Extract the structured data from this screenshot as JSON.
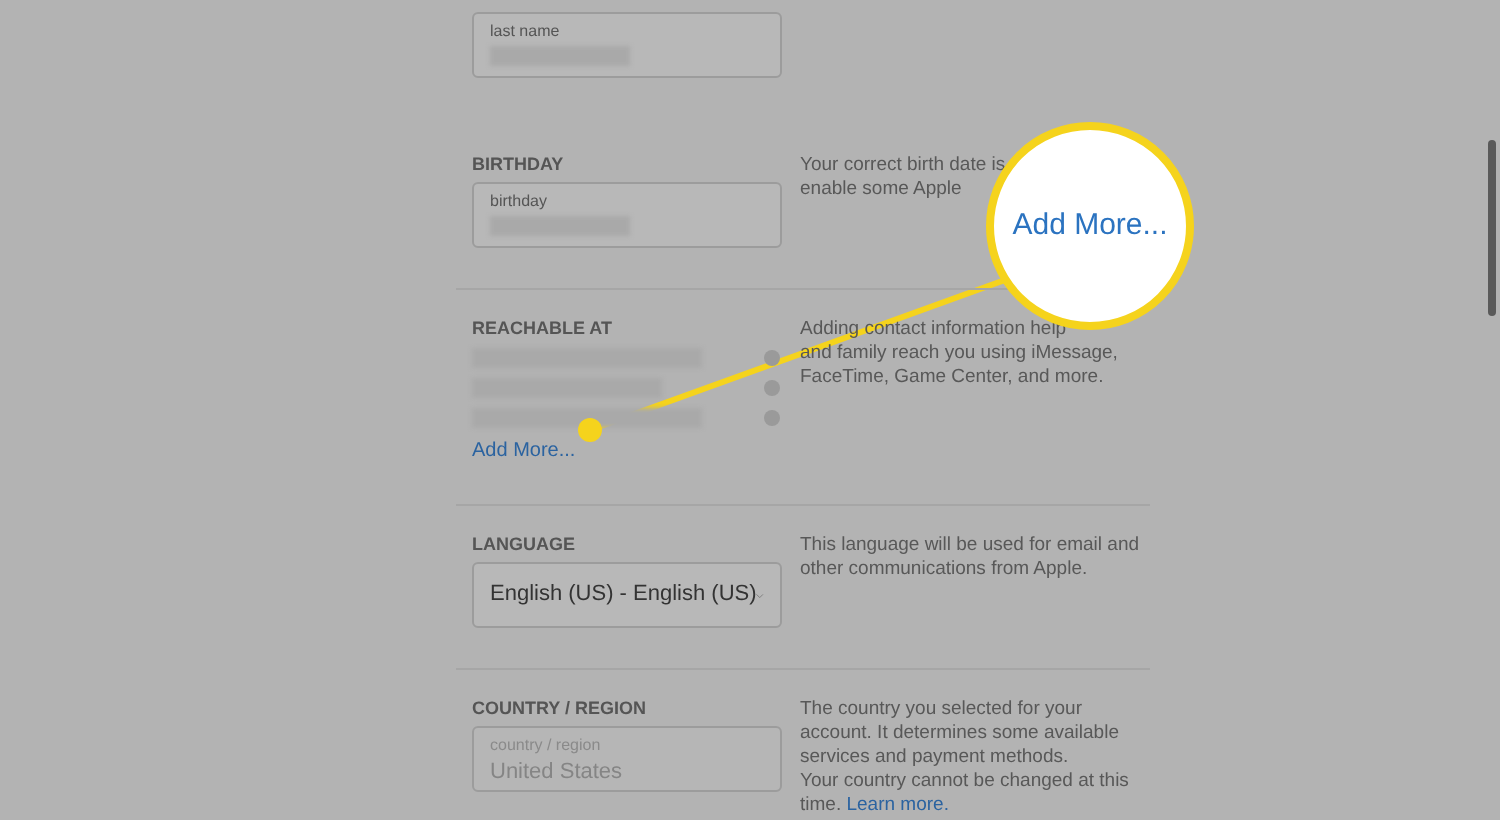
{
  "top_field": {
    "label": "last name"
  },
  "sections": [
    {
      "kind": "field",
      "heading": "BIRTHDAY",
      "field_label": "birthday",
      "disabled": false,
      "description": [
        "Your correct birth date is",
        "enable some Apple"
      ]
    },
    {
      "kind": "contacts",
      "heading": "REACHABLE AT",
      "entries": [
        {
          "kind": "redacted"
        },
        {
          "kind": "redacted"
        },
        {
          "kind": "redacted"
        }
      ],
      "link": "Add More...",
      "description": [
        "Adding contact information help",
        "and family reach you using iMessage,",
        "FaceTime, Game Center, and more."
      ]
    },
    {
      "kind": "select",
      "heading": "LANGUAGE",
      "value": "English (US) - English (US)",
      "description": [
        "This language will be used for email and",
        "other communications from Apple."
      ]
    },
    {
      "kind": "field",
      "heading": "COUNTRY / REGION",
      "field_label": "country / region",
      "value": "United States",
      "disabled": true,
      "description": [
        "The country you selected for your",
        "account. It determines some available",
        "services and payment methods.",
        "Your country cannot be changed at this",
        "time."
      ],
      "description_link": "Learn more."
    }
  ],
  "magnifier": {
    "text": "Add More..."
  }
}
